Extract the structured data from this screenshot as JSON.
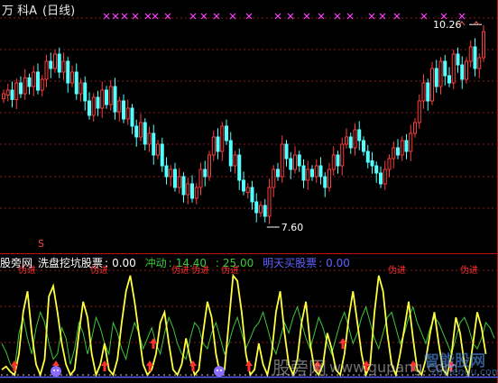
{
  "header": {
    "stock": "万 科A",
    "period": "(日线)"
  },
  "price_labels": {
    "high": "10.26",
    "low": "7.60",
    "signal_char": "S"
  },
  "indicator": {
    "site": "股旁网",
    "name": "洗盘挖坑股票",
    "name_value": "0.00",
    "chong_label": "冲动",
    "chong_value": "14.40",
    "level_value": "25.00",
    "mingtian_label": "明天买股票",
    "mingtian_value": "0.00",
    "marker_text": "伪进"
  },
  "watermarks": {
    "left": "股旁网",
    "url": "www.gupang.com",
    "brand": "智能股网",
    "brand_url": "zhinengu.com"
  },
  "colors": {
    "up": "#ff3c3c",
    "down": "#54ffff",
    "yellow_line": "#ffff40",
    "green_line": "#3cc83c",
    "grid": "#8a1a1a",
    "magenta": "#ff40ff",
    "white": "#ffffff",
    "blue": "#6060ff"
  },
  "chart_data": [
    {
      "type": "candlestick",
      "title": "万 科A (日线)",
      "annotations": [
        {
          "label": "10.26",
          "value": 10.26
        },
        {
          "label": "7.60",
          "value": 7.6
        }
      ],
      "ylim": [
        7.35,
        10.45
      ],
      "series": [
        {
          "name": "close",
          "values": [
            9.4,
            9.45,
            9.32,
            9.55,
            9.4,
            9.62,
            9.5,
            9.7,
            9.45,
            9.6,
            9.85,
            9.75,
            9.95,
            9.7,
            9.85,
            9.55,
            9.7,
            9.4,
            9.55,
            9.3,
            9.1,
            9.35,
            9.2,
            9.45,
            9.25,
            9.5,
            9.15,
            9.3,
            9.05,
            9.2,
            8.95,
            8.8,
            9.0,
            8.7,
            8.85,
            8.55,
            8.7,
            8.4,
            8.25,
            8.35,
            8.1,
            8.25,
            8.0,
            8.15,
            7.95,
            8.1,
            8.35,
            8.25,
            8.55,
            8.8,
            8.6,
            8.95,
            8.75,
            8.4,
            8.55,
            8.2,
            8.05,
            8.1,
            7.9,
            7.75,
            7.85,
            7.7,
            8.1,
            8.35,
            8.25,
            8.7,
            8.5,
            8.35,
            8.55,
            8.4,
            8.2,
            8.35,
            8.25,
            8.4,
            8.25,
            8.1,
            8.35,
            8.55,
            8.4,
            8.7,
            8.8,
            8.65,
            8.9,
            8.75,
            8.6,
            8.45,
            8.4,
            8.3,
            8.15,
            8.35,
            8.5,
            8.65,
            8.55,
            8.75,
            8.6,
            8.85,
            9.0,
            9.3,
            9.55,
            9.3,
            9.75,
            9.5,
            9.85,
            9.65,
            9.55,
            9.95,
            9.8,
            9.6,
            9.85,
            10.05,
            9.75,
            9.9,
            10.26
          ]
        },
        {
          "name": "direction",
          "values": [
            1,
            1,
            -1,
            1,
            -1,
            1,
            -1,
            1,
            -1,
            1,
            1,
            -1,
            1,
            -1,
            1,
            -1,
            1,
            -1,
            1,
            -1,
            -1,
            1,
            -1,
            1,
            -1,
            1,
            -1,
            1,
            -1,
            1,
            -1,
            -1,
            1,
            -1,
            1,
            -1,
            1,
            -1,
            -1,
            1,
            -1,
            1,
            -1,
            1,
            -1,
            1,
            1,
            -1,
            1,
            1,
            -1,
            1,
            -1,
            -1,
            1,
            -1,
            -1,
            1,
            -1,
            -1,
            1,
            -1,
            1,
            1,
            -1,
            1,
            -1,
            -1,
            1,
            -1,
            -1,
            1,
            -1,
            1,
            -1,
            -1,
            1,
            1,
            -1,
            1,
            1,
            -1,
            1,
            -1,
            -1,
            -1,
            -1,
            -1,
            -1,
            1,
            1,
            1,
            -1,
            1,
            -1,
            1,
            1,
            1,
            1,
            -1,
            1,
            -1,
            1,
            -1,
            -1,
            1,
            -1,
            -1,
            1,
            1,
            -1,
            1,
            1
          ]
        }
      ]
    },
    {
      "type": "line",
      "title": "洗盘挖坑股票",
      "ylim": [
        0,
        100
      ],
      "series": [
        {
          "name": "冲动",
          "values": [
            30,
            22,
            10,
            5,
            40,
            55,
            35,
            20,
            45,
            60,
            50,
            30,
            15,
            20,
            45,
            35,
            10,
            25,
            50,
            40,
            20,
            35,
            55,
            45,
            30,
            20,
            50,
            40,
            25,
            15,
            35,
            50,
            40,
            25,
            35,
            45,
            30,
            20,
            40,
            55,
            45,
            30,
            20,
            15,
            35,
            50,
            45,
            30,
            25,
            40,
            50,
            35,
            20,
            30,
            45,
            55,
            40,
            25,
            35,
            45,
            50,
            60,
            45,
            30,
            20,
            35,
            50,
            40,
            55,
            65,
            50,
            35,
            25,
            40,
            55,
            45,
            30,
            20,
            35,
            50,
            60,
            45,
            30,
            40,
            55,
            65,
            50,
            35,
            25,
            40,
            55,
            60,
            45,
            30,
            40,
            55,
            65,
            50,
            40,
            30,
            45,
            55,
            50,
            40,
            30,
            20,
            35,
            50,
            55,
            45,
            30,
            25,
            35,
            50,
            45,
            35
          ]
        },
        {
          "name": "明天买股票",
          "values": [
            5,
            8,
            3,
            0,
            20,
            60,
            80,
            40,
            10,
            0,
            15,
            75,
            85,
            60,
            30,
            10,
            0,
            5,
            40,
            70,
            55,
            20,
            0,
            10,
            30,
            5,
            0,
            15,
            50,
            80,
            95,
            70,
            40,
            10,
            0,
            5,
            20,
            50,
            60,
            30,
            5,
            0,
            10,
            35,
            15,
            0,
            5,
            40,
            70,
            55,
            20,
            0,
            5,
            50,
            95,
            90,
            60,
            20,
            0,
            5,
            30,
            10,
            0,
            20,
            60,
            80,
            40,
            10,
            0,
            15,
            50,
            70,
            30,
            5,
            0,
            10,
            40,
            25,
            5,
            0,
            20,
            55,
            80,
            50,
            20,
            0,
            10,
            60,
            95,
            80,
            40,
            10,
            0,
            20,
            45,
            70,
            35,
            5,
            0,
            15,
            40,
            60,
            30,
            5,
            0,
            20,
            55,
            40,
            10,
            0,
            30,
            60,
            45,
            20
          ]
        }
      ]
    }
  ]
}
